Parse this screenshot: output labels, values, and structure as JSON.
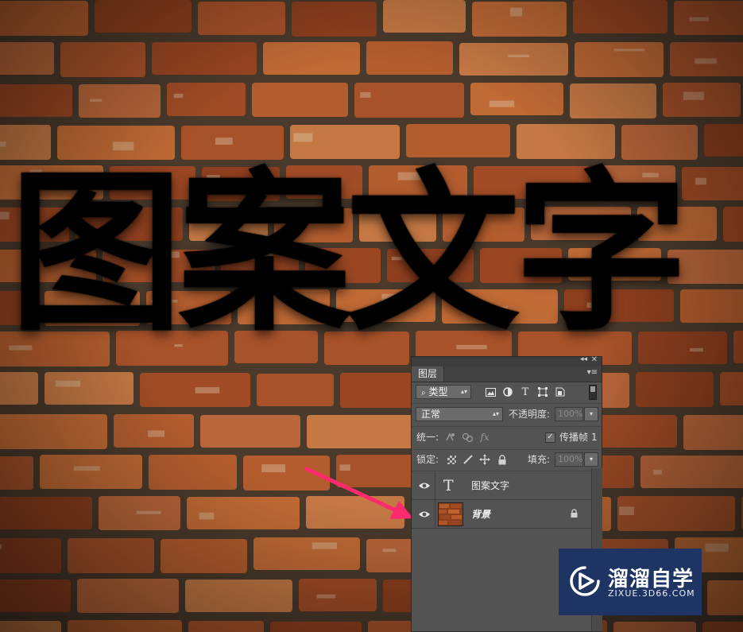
{
  "canvas": {
    "text": "图案文字"
  },
  "layers_panel": {
    "tab_label": "图层",
    "filter": {
      "selected": "类型"
    },
    "blend_mode": {
      "selected": "正常"
    },
    "opacity": {
      "label": "不透明度:",
      "value": "100%"
    },
    "unify": {
      "label": "统一:",
      "propagate_label": "传播帧",
      "frame": "1"
    },
    "lock": {
      "label": "锁定:"
    },
    "fill": {
      "label": "填充:",
      "value": "100%"
    },
    "layers": [
      {
        "name": "图案文字",
        "kind": "text"
      },
      {
        "name": "背景",
        "kind": "image",
        "locked": true
      }
    ]
  },
  "watermark": {
    "title": "溜溜自学",
    "url": "ZIXUE.3D66.COM"
  },
  "colors": {
    "panel_bg": "#535353",
    "arrow": "#ff2a6d",
    "watermark_bg": "#1e3463",
    "brick": "#a8522a"
  }
}
